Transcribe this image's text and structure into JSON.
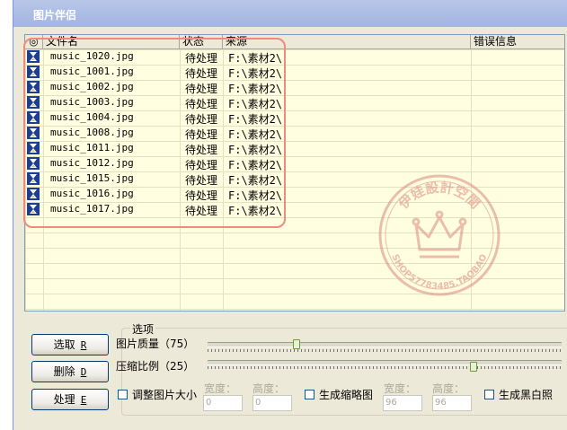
{
  "window": {
    "title": "图片伴侣"
  },
  "list": {
    "columns": [
      "◎",
      "文件名",
      "状态",
      "来源",
      "错误信息"
    ],
    "rows": [
      {
        "name": "music_1020.jpg",
        "status": "待处理",
        "source": "F:\\素材2\\"
      },
      {
        "name": "music_1001.jpg",
        "status": "待处理",
        "source": "F:\\素材2\\"
      },
      {
        "name": "music_1002.jpg",
        "status": "待处理",
        "source": "F:\\素材2\\"
      },
      {
        "name": "music_1003.jpg",
        "status": "待处理",
        "source": "F:\\素材2\\"
      },
      {
        "name": "music_1004.jpg",
        "status": "待处理",
        "source": "F:\\素材2\\"
      },
      {
        "name": "music_1008.jpg",
        "status": "待处理",
        "source": "F:\\素材2\\"
      },
      {
        "name": "music_1011.jpg",
        "status": "待处理",
        "source": "F:\\素材2\\"
      },
      {
        "name": "music_1012.jpg",
        "status": "待处理",
        "source": "F:\\素材2\\"
      },
      {
        "name": "music_1015.jpg",
        "status": "待处理",
        "source": "F:\\素材2\\"
      },
      {
        "name": "music_1016.jpg",
        "status": "待处理",
        "source": "F:\\素材2\\"
      },
      {
        "name": "music_1017.jpg",
        "status": "待处理",
        "source": "F:\\素材2\\"
      }
    ],
    "row_icon": "hourglass-icon"
  },
  "watermark": {
    "top_text": "伊娃設計空間",
    "bottom_text": "SHOP57783485.TAOBAO",
    "icon": "crown-icon"
  },
  "buttons": {
    "select": {
      "label": "选取",
      "key": "R"
    },
    "delete": {
      "label": "删除",
      "key": "D"
    },
    "process": {
      "label": "处理",
      "key": "E"
    }
  },
  "options": {
    "title": "选项",
    "quality": {
      "label": "图片质量（75）",
      "value": 75,
      "level": 0.25
    },
    "compression": {
      "label": "压缩比例（25）",
      "value": 25,
      "level": 0.75
    },
    "resize": {
      "label": "调整图片大小",
      "checked": false,
      "width_label": "宽度：",
      "width_value": "0",
      "height_label": "高度：",
      "height_value": "0"
    },
    "thumbnail": {
      "label": "生成缩略图",
      "checked": false,
      "width_label": "宽度：",
      "width_value": "96",
      "height_label": "高度：",
      "height_value": "96"
    },
    "grayscale": {
      "label": "生成黑白照",
      "checked": false
    }
  },
  "colors": {
    "highlight": "#ef8a7c",
    "list_bg": "#fffee0",
    "title_bg": "#aebfe6",
    "watermark": "#d98a80"
  }
}
